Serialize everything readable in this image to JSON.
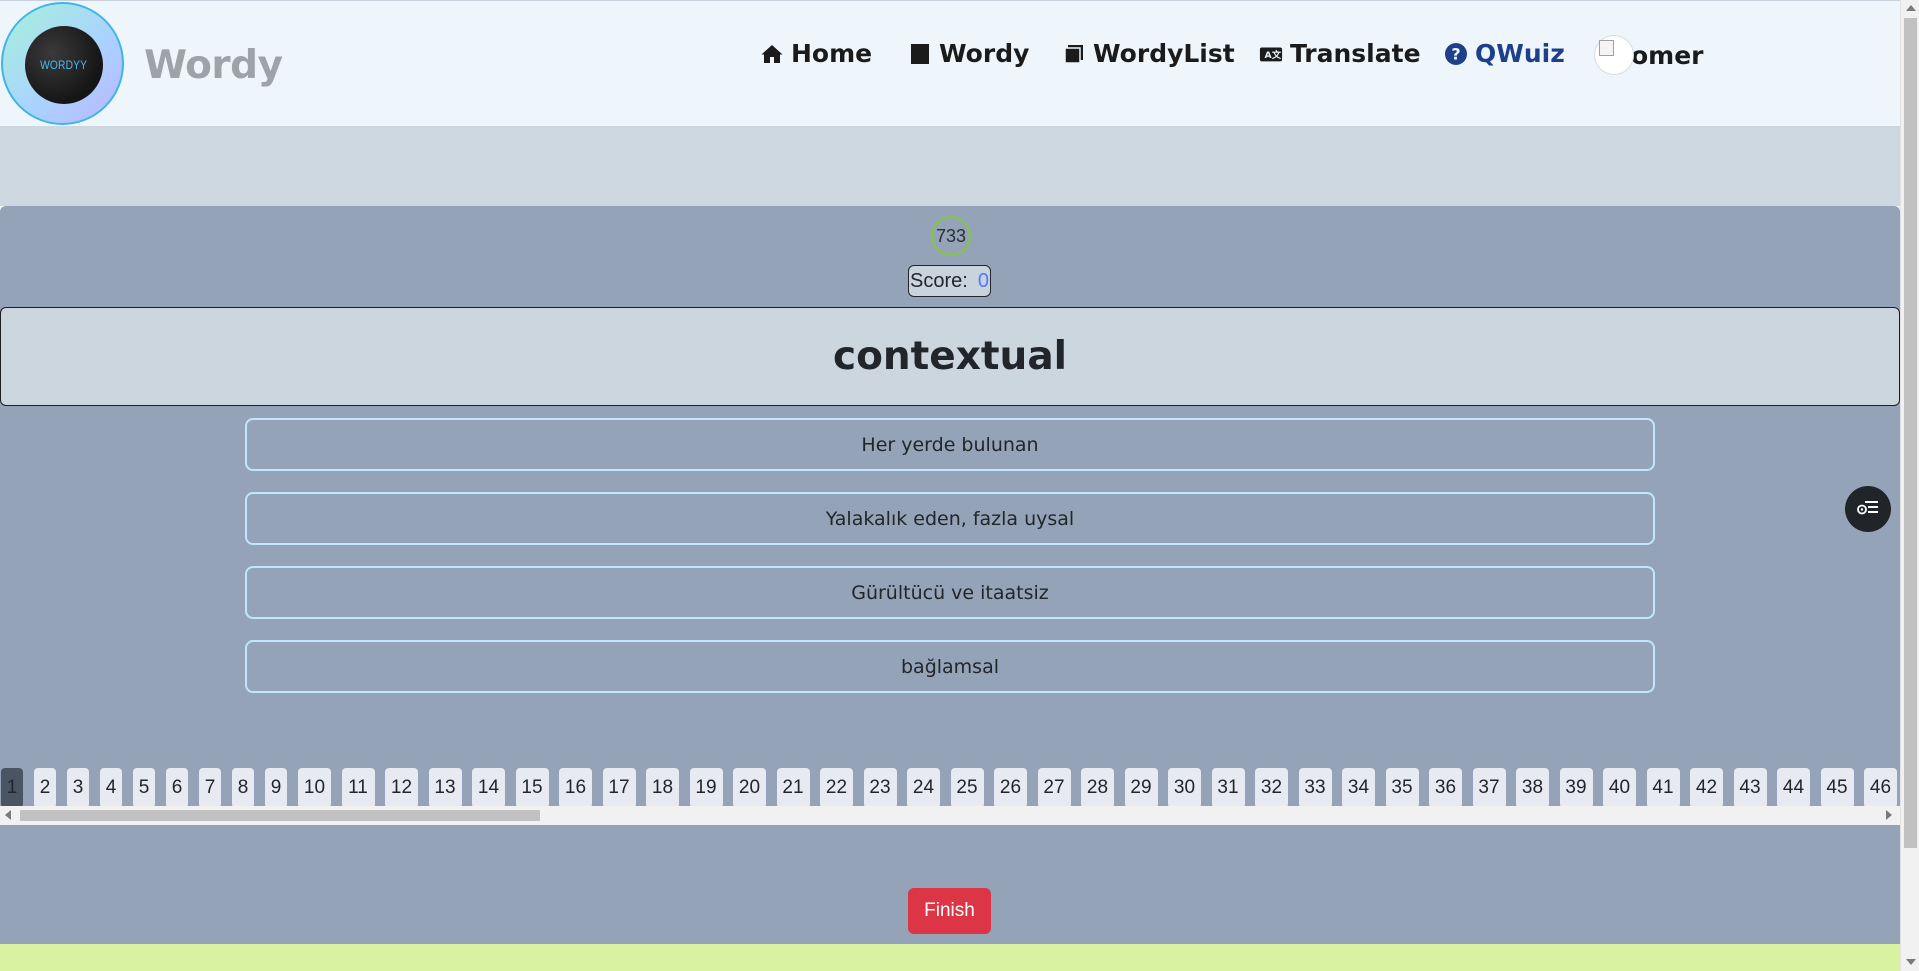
{
  "header": {
    "logo_text": "WORDYY",
    "brand": "Wordy",
    "nav": [
      {
        "label": "Home",
        "icon": "home-icon"
      },
      {
        "label": "Wordy",
        "icon": "square-icon"
      },
      {
        "label": "WordyList",
        "icon": "copy-icon"
      },
      {
        "label": "Translate",
        "icon": "translate-icon"
      },
      {
        "label": "QWuiz",
        "icon": "question-circle-icon"
      },
      {
        "label": "omer",
        "icon": "avatar"
      }
    ],
    "active_nav": "QWuiz"
  },
  "quiz": {
    "timer": "733",
    "score_label": "Score:",
    "score_value": "0",
    "word": "contextual",
    "options": [
      "Her yerde bulunan",
      "Yalakalık eden, fazla uysal",
      "Gürültücü ve itaatsiz",
      "bağlamsal"
    ],
    "pages": [
      "1",
      "2",
      "3",
      "4",
      "5",
      "6",
      "7",
      "8",
      "9",
      "10",
      "11",
      "12",
      "13",
      "14",
      "15",
      "16",
      "17",
      "18",
      "19",
      "20",
      "21",
      "22",
      "23",
      "24",
      "25",
      "26",
      "27",
      "28",
      "29",
      "30",
      "31",
      "32",
      "33",
      "34",
      "35",
      "36",
      "37",
      "38",
      "39",
      "40",
      "41",
      "42",
      "43",
      "44",
      "45",
      "46"
    ],
    "current_page": "1",
    "finish_label": "Finish"
  },
  "colors": {
    "header_bg": "#eef6fc",
    "quiz_bg": "#94a3b8",
    "active_nav": "#1e3f8a",
    "finish_bg": "#dc3545",
    "footer_strip": "#d8f2a2"
  }
}
